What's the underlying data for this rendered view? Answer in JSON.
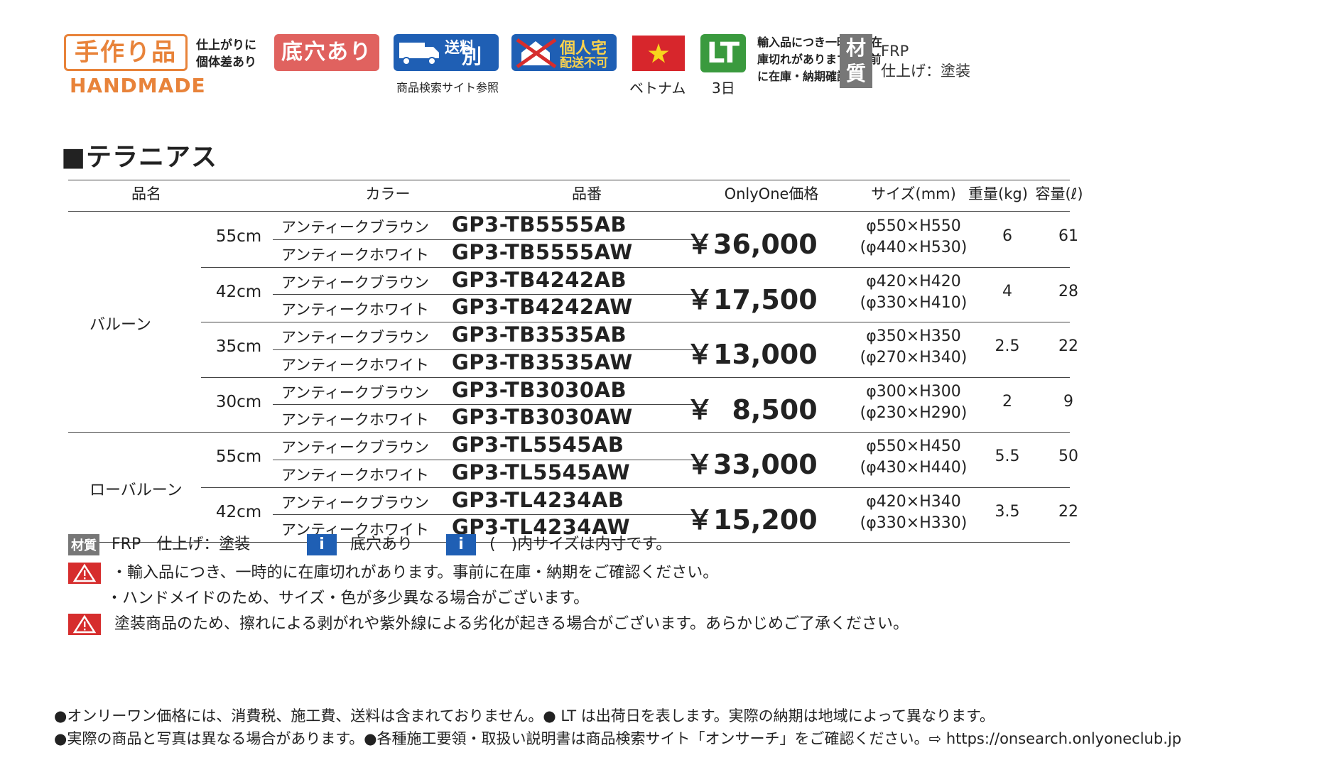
{
  "badges": {
    "handmade_jp": "手作り品",
    "handmade_en": "HANDMADE",
    "handmade_note_1": "仕上がりに",
    "handmade_note_2": "個体差あり",
    "sokoana": "底穴あり",
    "shipping_l1": "送料",
    "shipping_l2": "別途",
    "shipping_caption": "商品検索サイト参照",
    "home_l1": "個人宅",
    "home_l2": "配送不可",
    "country": "ベトナム",
    "lt": "LT",
    "lt_days": "3日",
    "stock_1": "輸入品につき一時的に在",
    "stock_2": "庫切れがあります。事前",
    "stock_3": "に在庫・納期確認。",
    "material_1": "材",
    "material_2": "質",
    "material_text_1": "FRP",
    "material_text_2": "仕上げ：塗装"
  },
  "heading": "■テラニアス",
  "table": {
    "headers": {
      "name": "品名",
      "color": "カラー",
      "code": "品番",
      "price": "OnlyOne価格",
      "size": "サイズ(mm)",
      "weight": "重量(kg)",
      "volume": "容量(ℓ)"
    },
    "groups": [
      {
        "name": "バルーン",
        "sizes": [
          {
            "size": "55cm",
            "colors": [
              "アンティークブラウン",
              "アンティークホワイト"
            ],
            "codes": [
              "GP3-TB5555AB",
              "GP3-TB5555AW"
            ],
            "price": "￥36,000",
            "dim_outer": "φ550×H550",
            "dim_inner": "(φ440×H530)",
            "weight": "6",
            "volume": "61"
          },
          {
            "size": "42cm",
            "colors": [
              "アンティークブラウン",
              "アンティークホワイト"
            ],
            "codes": [
              "GP3-TB4242AB",
              "GP3-TB4242AW"
            ],
            "price": "￥17,500",
            "dim_outer": "φ420×H420",
            "dim_inner": "(φ330×H410)",
            "weight": "4",
            "volume": "28"
          },
          {
            "size": "35cm",
            "colors": [
              "アンティークブラウン",
              "アンティークホワイト"
            ],
            "codes": [
              "GP3-TB3535AB",
              "GP3-TB3535AW"
            ],
            "price": "￥13,000",
            "dim_outer": "φ350×H350",
            "dim_inner": "(φ270×H340)",
            "weight": "2.5",
            "volume": "22"
          },
          {
            "size": "30cm",
            "colors": [
              "アンティークブラウン",
              "アンティークホワイト"
            ],
            "codes": [
              "GP3-TB3030AB",
              "GP3-TB3030AW"
            ],
            "price": "￥  8,500",
            "dim_outer": "φ300×H300",
            "dim_inner": "(φ230×H290)",
            "weight": "2",
            "volume": "9"
          }
        ]
      },
      {
        "name": "ローバルーン",
        "sizes": [
          {
            "size": "55cm",
            "colors": [
              "アンティークブラウン",
              "アンティークホワイト"
            ],
            "codes": [
              "GP3-TL5545AB",
              "GP3-TL5545AW"
            ],
            "price": "￥33,000",
            "dim_outer": "φ550×H450",
            "dim_inner": "(φ430×H440)",
            "weight": "5.5",
            "volume": "50"
          },
          {
            "size": "42cm",
            "colors": [
              "アンティークブラウン",
              "アンティークホワイト"
            ],
            "codes": [
              "GP3-TL4234AB",
              "GP3-TL4234AW"
            ],
            "price": "￥15,200",
            "dim_outer": "φ420×H340",
            "dim_inner": "(φ330×H330)",
            "weight": "3.5",
            "volume": "22"
          }
        ]
      }
    ]
  },
  "notes": {
    "material_tag": "材質",
    "material_text": "FRP　仕上げ：塗装",
    "info_icon": "i",
    "info1_text": "底穴あり",
    "info2_text": "(　)内サイズは内寸です。",
    "warn1_line1": "・輸入品につき、一時的に在庫切れがあります。事前に在庫・納期をご確認ください。",
    "warn1_line2": "・ハンドメイドのため、サイズ・色が多少異なる場合がございます。",
    "warn2": "塗装商品のため、擦れによる剥がれや紫外線による劣化が起きる場合がございます。あらかじめご了承ください。"
  },
  "footer": {
    "line1": "●オンリーワン価格には、消費税、施工費、送料は含まれておりません。● LT は出荷日を表します。実際の納期は地域によって異なります。",
    "line2": "●実際の商品と写真は異なる場合があります。●各種施工要領・取扱い説明書は商品検索サイト「オンサーチ」をご確認ください。⇨ https://onsearch.onlyoneclub.jp"
  },
  "colors": {
    "handmade": "#e8833a",
    "sokoana": "#e0625f",
    "blue_badge": "#1f5fb4",
    "lt": "#3a9a3e",
    "warn": "#d62d2d",
    "material": "#777777"
  }
}
